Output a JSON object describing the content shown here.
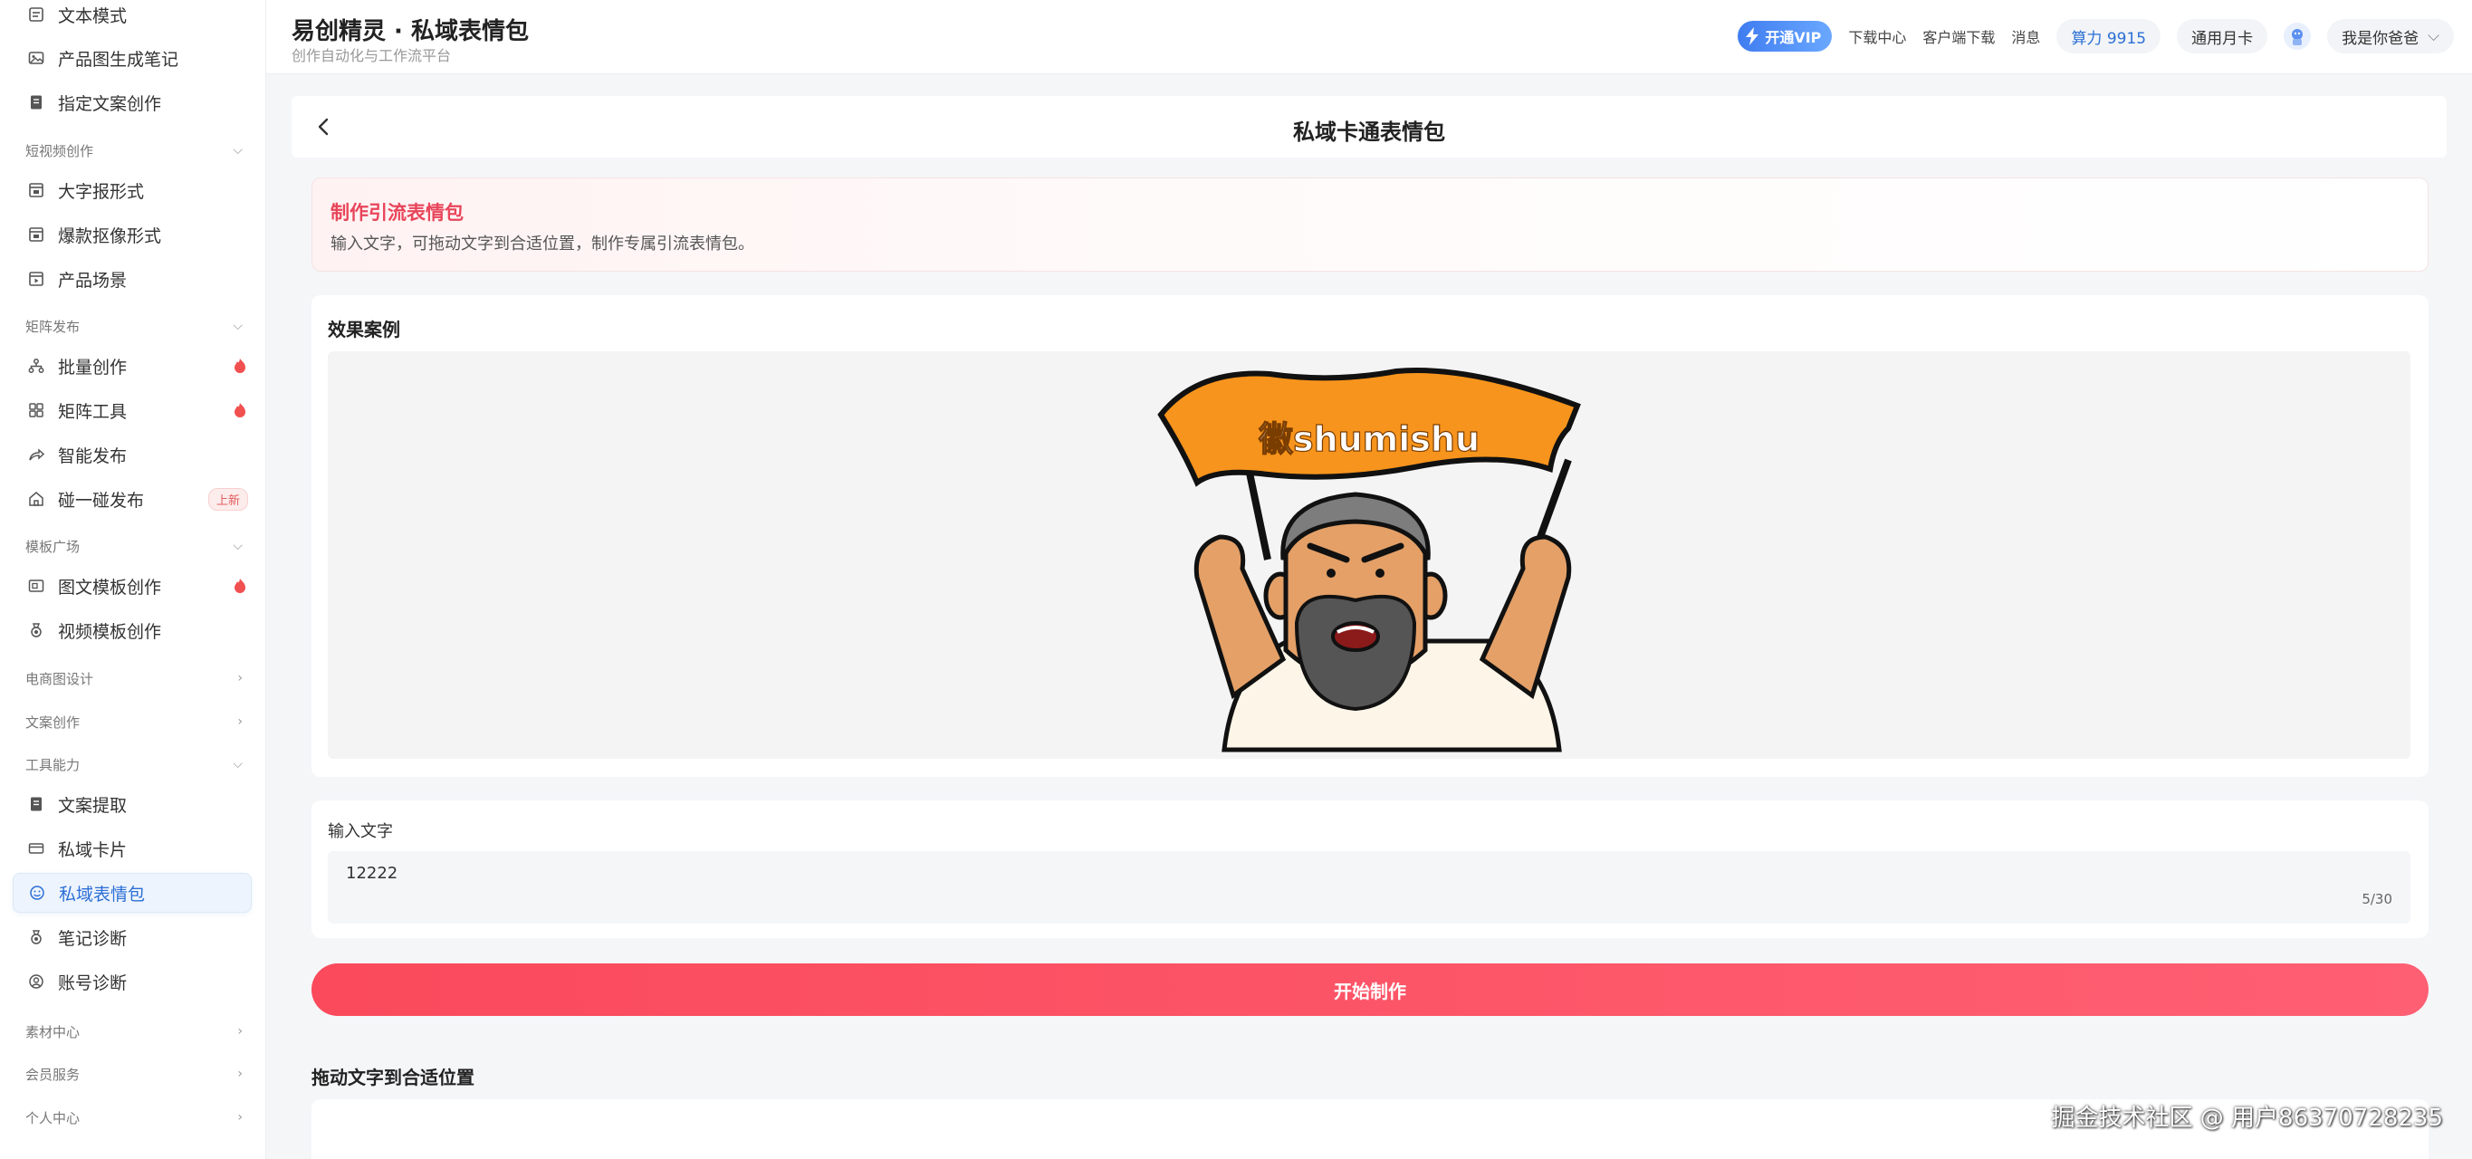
{
  "sidebar": {
    "items": [
      {
        "label": "文本模式",
        "icon": "document-icon"
      },
      {
        "label": "产品图生成笔记",
        "icon": "image-icon"
      },
      {
        "label": "指定文案创作",
        "icon": "note-icon"
      },
      {
        "label": "大字报形式",
        "icon": "layout-icon"
      },
      {
        "label": "爆款抠像形式",
        "icon": "layout-icon"
      },
      {
        "label": "产品场景",
        "icon": "play-icon"
      },
      {
        "label": "批量创作",
        "icon": "tree-icon",
        "hot": true
      },
      {
        "label": "矩阵工具",
        "icon": "grid-icon",
        "hot": true
      },
      {
        "label": "智能发布",
        "icon": "share-icon"
      },
      {
        "label": "碰一碰发布",
        "icon": "home-icon",
        "badge": "上新"
      },
      {
        "label": "图文模板创作",
        "icon": "picture-frame-icon",
        "hot": true
      },
      {
        "label": "视频模板创作",
        "icon": "medal-icon"
      },
      {
        "label": "文案提取",
        "icon": "note-icon"
      },
      {
        "label": "私域卡片",
        "icon": "card-icon"
      },
      {
        "label": "私域表情包",
        "icon": "smile-icon",
        "active": true
      },
      {
        "label": "笔记诊断",
        "icon": "medal-icon"
      },
      {
        "label": "账号诊断",
        "icon": "user-circle-icon"
      }
    ],
    "groups": [
      {
        "label": "短视频创作",
        "expanded": true
      },
      {
        "label": "矩阵发布",
        "expanded": true
      },
      {
        "label": "模板广场",
        "expanded": true
      },
      {
        "label": "电商图设计",
        "expanded": false
      },
      {
        "label": "文案创作",
        "expanded": false
      },
      {
        "label": "工具能力",
        "expanded": true
      },
      {
        "label": "素材中心",
        "expanded": false
      },
      {
        "label": "会员服务",
        "expanded": false
      },
      {
        "label": "个人中心",
        "expanded": false
      }
    ]
  },
  "header": {
    "title": "易创精灵 · 私域表情包",
    "subtitle": "创作自动化与工作流平台",
    "vip": "开通VIP",
    "download_center": "下载中心",
    "client_download": "客户端下载",
    "messages": "消息",
    "compute": "算力 9915",
    "monthly_card": "通用月卡",
    "username": "我是你爸爸"
  },
  "page": {
    "title": "私域卡通表情包"
  },
  "notice": {
    "title": "制作引流表情包",
    "text": "输入文字，可拖动文字到合适位置，制作专属引流表情包。"
  },
  "example": {
    "heading": "效果案例",
    "banner_text": "徽shumishu"
  },
  "input": {
    "label": "输入文字",
    "value": "12222",
    "counter": "5/30"
  },
  "start_button": "开始制作",
  "drag_heading": "拖动文字到合适位置",
  "watermark": "掘金技术社区 @ 用户86370728235",
  "colors": {
    "accent_blue": "#2b6fd6",
    "accent_red": "#fa4a5c",
    "banner_orange": "#f7941d"
  }
}
